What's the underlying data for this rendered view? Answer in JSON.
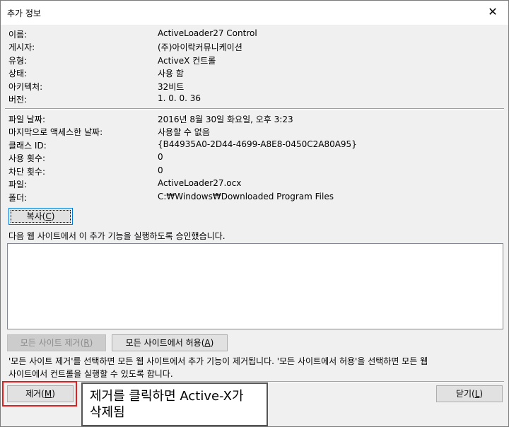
{
  "window": {
    "title": "추가 정보",
    "close_glyph": "✕"
  },
  "info_group1": [
    {
      "label": "이름:",
      "value": "ActiveLoader27 Control"
    },
    {
      "label": "게시자:",
      "value": "(주)아이락커뮤니케이션"
    },
    {
      "label": "유형:",
      "value": "ActiveX 컨트롤"
    },
    {
      "label": "상태:",
      "value": "사용 함"
    },
    {
      "label": "아키텍처:",
      "value": "32비트"
    },
    {
      "label": "버전:",
      "value": "1. 0. 0. 36"
    }
  ],
  "info_group2": [
    {
      "label": "파일 날짜:",
      "value": "2016년 8월 30일 화요일, 오후 3:23"
    },
    {
      "label": "마지막으로 액세스한 날짜:",
      "value": "사용할 수 없음"
    },
    {
      "label": "클래스 ID:",
      "value": "{B44935A0-2D44-4699-A8E8-0450C2A80A95}"
    },
    {
      "label": "사용 횟수:",
      "value": "0"
    },
    {
      "label": "차단 횟수:",
      "value": "0"
    },
    {
      "label": "파일:",
      "value": "ActiveLoader27.ocx"
    },
    {
      "label": "폴더:",
      "value": "C:₩Windows₩Downloaded Program Files"
    }
  ],
  "buttons": {
    "copy": {
      "text": "복사(",
      "key": "C",
      "end": ")"
    },
    "remove_all": {
      "text": "모든 사이트 제거(",
      "key": "R",
      "end": ")"
    },
    "allow_all": {
      "text": "모든 사이트에서 허용(",
      "key": "A",
      "end": ")"
    },
    "remove": {
      "text": "제거(",
      "key": "M",
      "end": ")"
    },
    "close": {
      "text": "닫기(",
      "key": "L",
      "end": ")"
    }
  },
  "sites_caption": "다음 웹 사이트에서 이 추가 기능을 실행하도록 승인했습니다.",
  "description": {
    "line1": "'모든 사이트 제거'를 선택하면 모든 웹 사이트에서 추가 기능이 제거됩니다. '모든 사이트에서 허용'을 선택하면 모든 웹",
    "line2": "사이트에서 컨트롤을 실행할 수 있도록 합니다."
  },
  "annotation": {
    "line1": "제거를 클릭하면 Active-X가",
    "line2": "삭제됨",
    "highlight_color": "#e02020"
  }
}
